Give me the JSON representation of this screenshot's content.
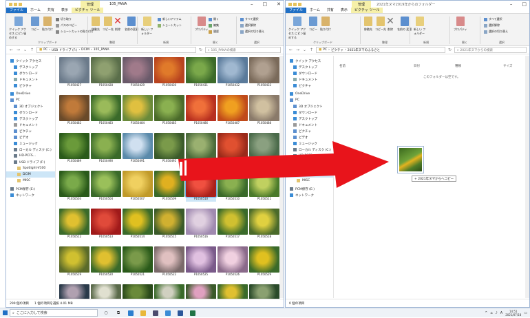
{
  "left_window": {
    "title": "105_PANA",
    "context_tab": "管理",
    "tabs": [
      "ファイル",
      "ホーム",
      "共有",
      "表示",
      "ピクチャ ツール"
    ],
    "ribbon": {
      "pin_label": "クイック アクセス にピン留めする",
      "copy_label": "コピー",
      "paste_label": "貼り付け",
      "cut_label": "切り取り",
      "copy_path_label": "パスのコピー",
      "paste_shortcut_label": "ショートカットの貼り付け",
      "move_to_label": "移動先",
      "copy_to_label": "コピー先",
      "delete_label": "削除",
      "rename_label": "名前の変更",
      "new_folder_label": "新しい フォルダー",
      "new_item_label": "新しいアイテム",
      "easy_access_label": "ショートカット",
      "properties_label": "プロパティ",
      "open_label": "開く",
      "edit_label": "編集",
      "history_label": "履歴",
      "select_all_label": "すべて選択",
      "select_none_label": "選択解除",
      "invert_label": "選択の切り替え",
      "group_clipboard": "クリップボード",
      "group_organize": "整理",
      "group_new": "新規",
      "group_open": "開く",
      "group_select": "選択"
    },
    "breadcrumb": [
      "PC",
      "USB ドライブ (F:)",
      "DCIM",
      "105_PANA"
    ],
    "search_placeholder": "105_PANAの検索",
    "nav_items": [
      "クイック アクセス",
      "デスクトップ",
      "ダウンロード",
      "ドキュメント",
      "ピクチャ",
      "OneDrive",
      "PC",
      "3D オブジェクト",
      "ダウンロード",
      "デスクトップ",
      "ドキュメント",
      "ピクチャ",
      "ビデオ",
      "ミュージック",
      "ローカル ディスク (C:)",
      "HD-PCFS...",
      "USB ドライブ (F:)",
      "Spotlight-V100",
      "DCIM",
      "MISC",
      "PCM保存 (E:)",
      "ネットワーク"
    ],
    "files": [
      "P1050427",
      "P1050428",
      "P1050429",
      "P1050430",
      "P1050431",
      "P1050432",
      "P1050433",
      "P1050482",
      "P1050483",
      "P1050484",
      "P1050485",
      "P1050486",
      "P1050487",
      "P1050488",
      "P1050489",
      "P1050490",
      "P1050491",
      "P1050492",
      "P1050493",
      "P1050494",
      "P1050495",
      "P1050503",
      "P1050504",
      "P1050507",
      "P1050509",
      "P1050510",
      "P1050510",
      "P1050511",
      "P1050512",
      "P1050513",
      "P1050514",
      "P1050515",
      "P1050516",
      "P1050517",
      "P1050518",
      "P1050519",
      "P1050520",
      "P1050521",
      "P1050522",
      "P1050525",
      "P1050526",
      "P1050529",
      "P1050530",
      "P1050531",
      "P1050532",
      "P1050533",
      "P1050534",
      "P1050535",
      "P1050536"
    ],
    "status_count": "299 個の項目",
    "status_selected": "1 個の項目を選択 4.01 MB"
  },
  "right_window": {
    "title": "2021年ヌマ2019年からのフォルダー",
    "context_tab": "管理",
    "tabs": [
      "ファイル",
      "ホーム",
      "共有",
      "表示",
      "ピクチャ ツール"
    ],
    "ribbon": {
      "pin_label": "クイック アクセス にピン留めする",
      "copy_label": "コピー",
      "paste_label": "貼り付け",
      "move_to_label": "移動先",
      "copy_to_label": "コピー先",
      "delete_label": "削除",
      "rename_label": "名前の 変更",
      "new_folder_label": "新しい フォルダー",
      "properties_label": "プロパティ",
      "select_all_label": "すべて選択",
      "select_none_label": "選択解除",
      "invert_label": "選択の切り替え",
      "group_clipboard": "クリップボード",
      "group_organize": "整理",
      "group_new": "新規",
      "group_open": "開く",
      "group_select": "選択"
    },
    "breadcrumb": [
      "PC",
      "ピクチャ",
      "2021年ヌマのふるさと"
    ],
    "search_placeholder": "2021年ヌマからの検索",
    "columns": [
      "名前",
      "日付",
      "種類",
      "サイズ"
    ],
    "empty_message": "このフォルダーは空です。",
    "nav_items": [
      "クイック アクセス",
      "デスクトップ",
      "ダウンロード",
      "ドキュメント",
      "ピクチャ",
      "OneDrive",
      "PC",
      "3D オブジェクト",
      "ダウンロード",
      "デスクトップ",
      "ドキュメント",
      "ピクチャ",
      "ビデオ",
      "ミュージック",
      "ローカル ディスク (C:)",
      "HD-PCFS...",
      "USB ドライブ (F:)",
      "Spotlight-V100",
      "DCIM",
      "MISC",
      "PCM保存 (E:)",
      "ネットワーク"
    ],
    "status_count": "0 個の項目"
  },
  "drag_tip": "+ 2021年ヌマからへコピー",
  "taskbar": {
    "search_placeholder": "ここに入力して検索",
    "time": "14:51",
    "date": "2021/07/18"
  }
}
